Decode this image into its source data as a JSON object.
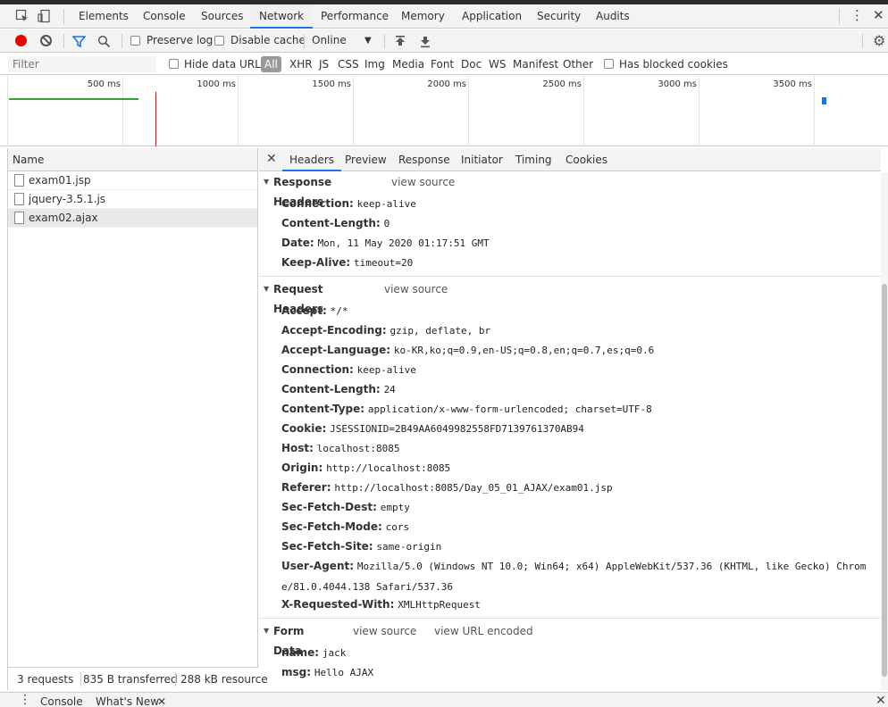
{
  "main_tabs": [
    "Elements",
    "Console",
    "Sources",
    "Network",
    "Performance",
    "Memory",
    "Application",
    "Security",
    "Audits"
  ],
  "active_main_tab": "Network",
  "toolbar": {
    "preserve_log": "Preserve log",
    "disable_cache": "Disable cache",
    "throttle": "Online"
  },
  "filterbar": {
    "filter_placeholder": "Filter",
    "hide_data_urls": "Hide data URLs",
    "types": [
      "All",
      "XHR",
      "JS",
      "CSS",
      "Img",
      "Media",
      "Font",
      "Doc",
      "WS",
      "Manifest",
      "Other"
    ],
    "has_blocked_cookies": "Has blocked cookies"
  },
  "overview": {
    "ticks": [
      "500 ms",
      "1000 ms",
      "1500 ms",
      "2000 ms",
      "2500 ms",
      "3000 ms",
      "3500 ms"
    ]
  },
  "request_list": {
    "header": "Name",
    "items": [
      "exam01.jsp",
      "jquery-3.5.1.js",
      "exam02.ajax"
    ],
    "selected": "exam02.ajax"
  },
  "status": {
    "requests": "3 requests",
    "transferred": "835 B transferred",
    "resources": "288 kB resource"
  },
  "detail_tabs": [
    "Headers",
    "Preview",
    "Response",
    "Initiator",
    "Timing",
    "Cookies"
  ],
  "active_detail_tab": "Headers",
  "response_headers": {
    "title": "Response Headers",
    "view_source": "view source",
    "rows": [
      {
        "name": "Connection:",
        "value": "keep-alive"
      },
      {
        "name": "Content-Length:",
        "value": "0"
      },
      {
        "name": "Date:",
        "value": "Mon, 11 May 2020 01:17:51 GMT"
      },
      {
        "name": "Keep-Alive:",
        "value": "timeout=20"
      }
    ]
  },
  "request_headers": {
    "title": "Request Headers",
    "view_source": "view source",
    "rows": [
      {
        "name": "Accept:",
        "value": "*/*"
      },
      {
        "name": "Accept-Encoding:",
        "value": "gzip, deflate, br"
      },
      {
        "name": "Accept-Language:",
        "value": "ko-KR,ko;q=0.9,en-US;q=0.8,en;q=0.7,es;q=0.6"
      },
      {
        "name": "Connection:",
        "value": "keep-alive"
      },
      {
        "name": "Content-Length:",
        "value": "24"
      },
      {
        "name": "Content-Type:",
        "value": "application/x-www-form-urlencoded; charset=UTF-8"
      },
      {
        "name": "Cookie:",
        "value": "JSESSIONID=2B49AA6049982558FD7139761370AB94"
      },
      {
        "name": "Host:",
        "value": "localhost:8085"
      },
      {
        "name": "Origin:",
        "value": "http://localhost:8085"
      },
      {
        "name": "Referer:",
        "value": "http://localhost:8085/Day_05_01_AJAX/exam01.jsp"
      },
      {
        "name": "Sec-Fetch-Dest:",
        "value": "empty"
      },
      {
        "name": "Sec-Fetch-Mode:",
        "value": "cors"
      },
      {
        "name": "Sec-Fetch-Site:",
        "value": "same-origin"
      },
      {
        "name": "User-Agent:",
        "value": "Mozilla/5.0 (Windows NT 10.0; Win64; x64) AppleWebKit/537.36 (KHTML, like Gecko) Chrome/81.0.4044.138 Safari/537.36"
      },
      {
        "name": "X-Requested-With:",
        "value": "XMLHttpRequest"
      }
    ]
  },
  "form_data": {
    "title": "Form Data",
    "view_source": "view source",
    "view_url_encoded": "view URL encoded",
    "rows": [
      {
        "name": "name:",
        "value": "jack"
      },
      {
        "name": "msg:",
        "value": "Hello AJAX"
      }
    ]
  },
  "drawer": {
    "tabs": [
      "Console",
      "What's New"
    ]
  }
}
